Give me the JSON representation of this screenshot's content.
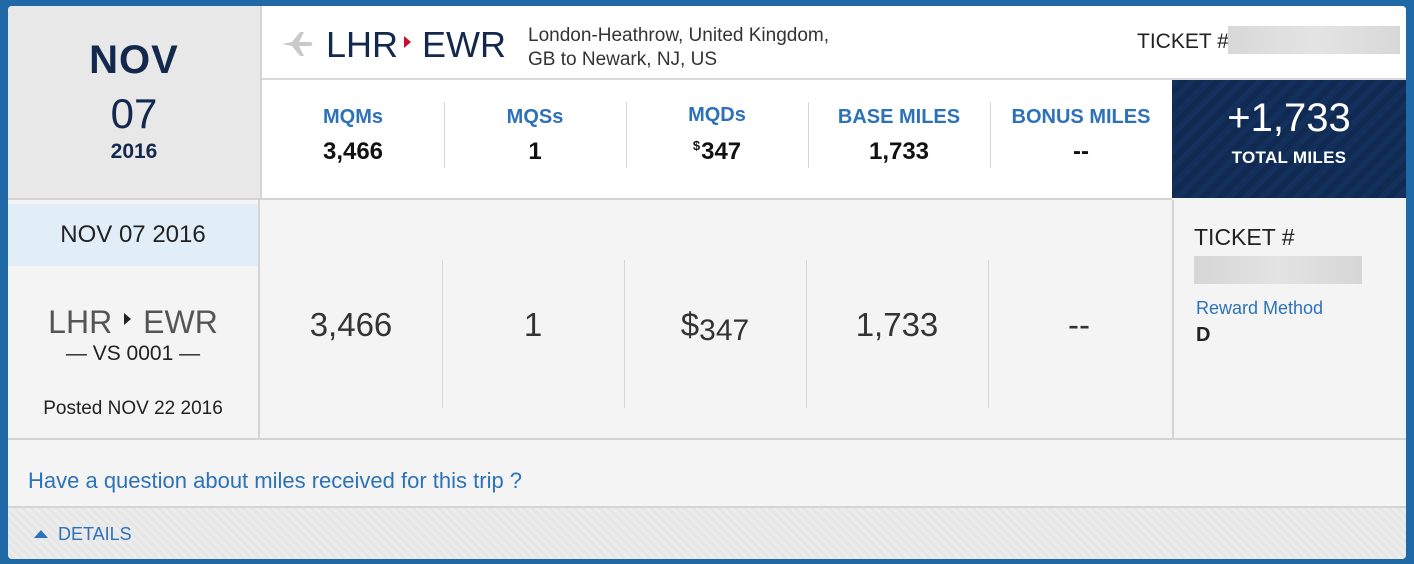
{
  "header": {
    "date": {
      "month": "NOV",
      "day": "07",
      "year": "2016"
    },
    "route": {
      "origin": "LHR",
      "destination": "EWR",
      "description_line1": "London-Heathrow, United Kingdom,",
      "description_line2": "GB to Newark, NJ, US"
    },
    "ticket_label": "TICKET #"
  },
  "stats": [
    {
      "label": "MQMs",
      "value": "3,466"
    },
    {
      "label": "MQSs",
      "value": "1"
    },
    {
      "label": "MQDs",
      "currency": "$",
      "value": "347"
    },
    {
      "label": "BASE MILES",
      "value": "1,733"
    },
    {
      "label": "BONUS MILES",
      "value": "--"
    }
  ],
  "total": {
    "value": "+1,733",
    "label": "TOTAL MILES"
  },
  "segment": {
    "date": "NOV 07 2016",
    "origin": "LHR",
    "destination": "EWR",
    "flight": "— VS 0001 —",
    "posted": "Posted NOV 22 2016",
    "values": [
      "3,466",
      "1",
      "347",
      "1,733",
      "--"
    ],
    "mqd_currency": "$",
    "ticket_label": "TICKET #",
    "reward_label": "Reward Method",
    "reward_value": "D"
  },
  "question_link": "Have a question about miles received for this trip ?",
  "details_toggle": "DETAILS",
  "colors": {
    "brand_navy": "#13284d",
    "link_blue": "#2d72b8",
    "route_arrow": "#c8102e",
    "frame": "#1f6aa6"
  },
  "icons": {
    "plane": "plane-icon",
    "route_arrow": "route-arrow-icon",
    "details_caret": "caret-up-icon"
  }
}
